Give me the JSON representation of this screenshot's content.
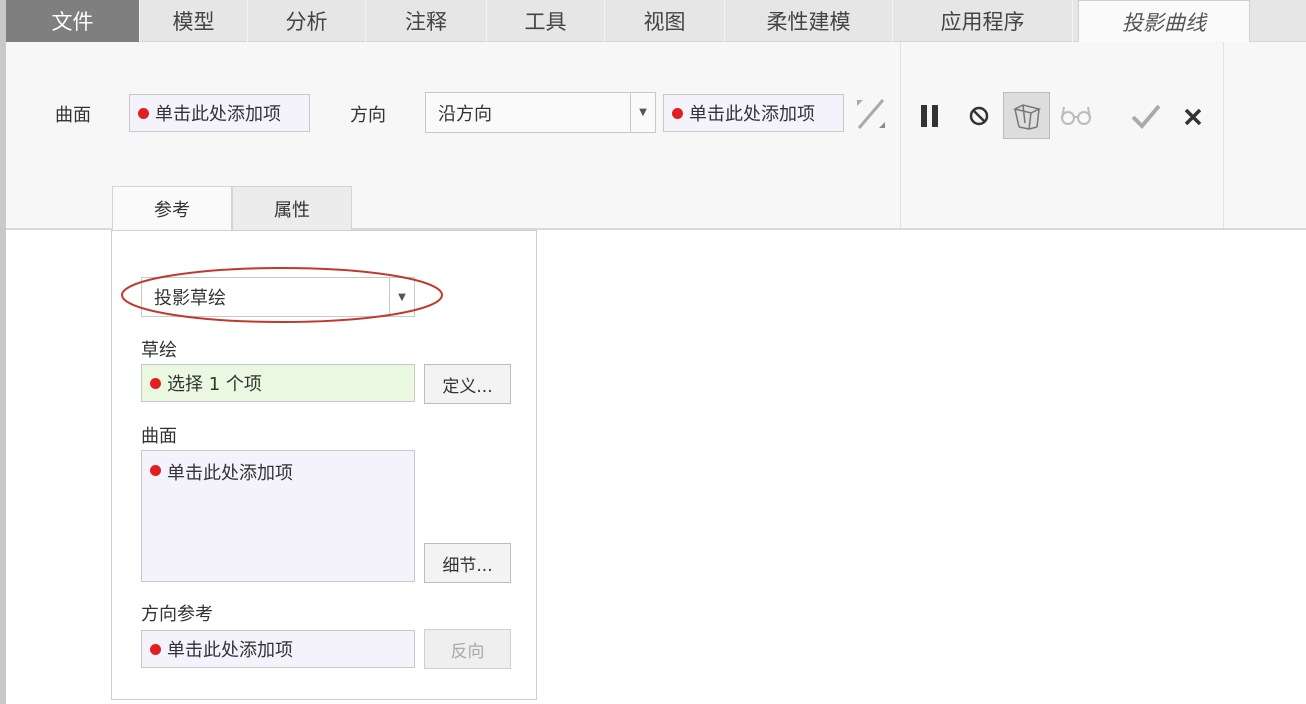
{
  "tabs": [
    {
      "label": "文件"
    },
    {
      "label": "模型"
    },
    {
      "label": "分析"
    },
    {
      "label": "注释"
    },
    {
      "label": "工具"
    },
    {
      "label": "视图"
    },
    {
      "label": "柔性建模"
    },
    {
      "label": "应用程序"
    },
    {
      "label": "投影曲线"
    }
  ],
  "ribbon": {
    "surface_label": "曲面",
    "surface_field": "单击此处添加项",
    "direction_label": "方向",
    "direction_value": "沿方向",
    "direction_ref_field": "单击此处添加项",
    "icons": [
      "flip-direction-icon",
      "pause-icon",
      "no-preview-icon",
      "geometry-preview-icon",
      "verify-glasses-icon",
      "ok-check-icon",
      "cancel-x-icon"
    ]
  },
  "subtabs": [
    {
      "label": "参考"
    },
    {
      "label": "属性"
    }
  ],
  "panel": {
    "type_value": "投影草绘",
    "sketch_label": "草绘",
    "sketch_field": "选择 1 个项",
    "define_button": "定义...",
    "surface_label": "曲面",
    "surface_field": "单击此处添加项",
    "details_button": "细节...",
    "dirref_label": "方向参考",
    "dirref_field": "单击此处添加项",
    "flip_button": "反向"
  },
  "colors": {
    "required_dot": "#e02020",
    "highlight_ellipse": "#c0392b"
  }
}
